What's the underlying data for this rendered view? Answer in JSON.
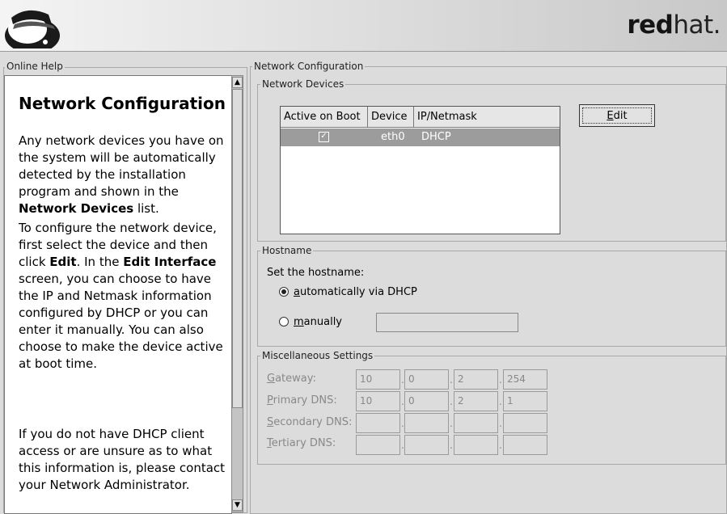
{
  "brand": {
    "bold": "red",
    "thin": "hat."
  },
  "help": {
    "frame_title": "Online Help",
    "heading": "Network Configuration",
    "p1_a": "Any network devices you have on the system will be automatically detected by the installation program and shown in the ",
    "p1_b": "Network Devices",
    "p1_c": " list.",
    "p2_a": "To configure the network device, first select the device and then click ",
    "p2_b": "Edit",
    "p2_c": ". In the ",
    "p2_d": "Edit Interface",
    "p2_e": " screen, you can choose to have the IP and Netmask information configured by DHCP or you can enter it manually. You can also choose to make the device active at boot time.",
    "p3": "If you do not have DHCP client access or are unsure as to what this information is, please contact your Network Administrator."
  },
  "network": {
    "frame_title": "Network Configuration",
    "devices": {
      "frame_title": "Network Devices",
      "columns": [
        "Active on Boot",
        "Device",
        "IP/Netmask"
      ],
      "rows": [
        {
          "active_mark": "✓",
          "device": "eth0",
          "ip": "DHCP"
        }
      ],
      "edit_key": "E",
      "edit_rest": "dit"
    },
    "hostname": {
      "frame_title": "Hostname",
      "prompt": "Set the hostname:",
      "auto_key": "a",
      "auto_rest": "utomatically via DHCP",
      "manual_key": "m",
      "manual_rest": "anually",
      "selected": "automatically via DHCP",
      "manual_value": ""
    },
    "misc": {
      "frame_title": "Miscellaneous Settings",
      "gateway": {
        "key": "G",
        "rest": "ateway:",
        "octets": [
          "10",
          "0",
          "2",
          "254"
        ]
      },
      "primary_dns": {
        "key": "P",
        "rest": "rimary DNS:",
        "octets": [
          "10",
          "0",
          "2",
          "1"
        ]
      },
      "secondary_dns": {
        "key": "S",
        "rest": "econdary DNS:",
        "octets": [
          "",
          "",
          "",
          ""
        ]
      },
      "tertiary_dns": {
        "key": "T",
        "rest": "ertiary DNS:",
        "octets": [
          "",
          "",
          "",
          ""
        ]
      }
    }
  },
  "icons": {
    "logo": "shadowman-logo-icon",
    "scroll_up": "arrow-up-icon",
    "scroll_down": "arrow-down-icon"
  }
}
